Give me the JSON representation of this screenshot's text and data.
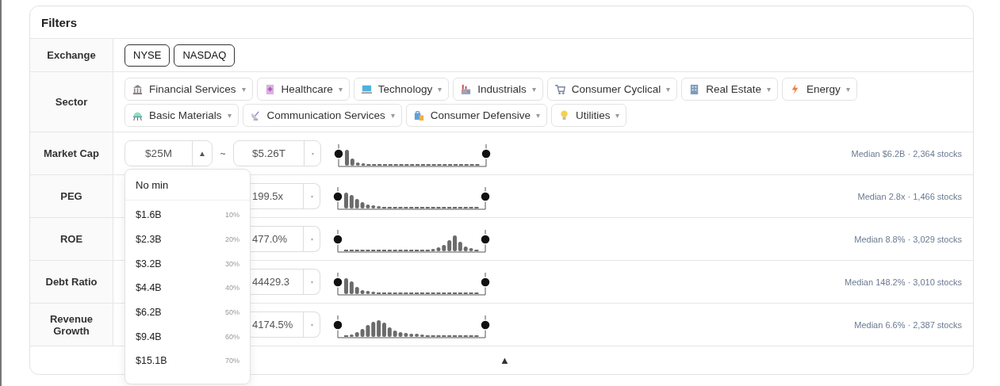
{
  "title": "Filters",
  "exchange": {
    "label": "Exchange",
    "options": [
      {
        "label": "NYSE"
      },
      {
        "label": "NASDAQ"
      }
    ]
  },
  "sector": {
    "label": "Sector",
    "options": [
      {
        "label": "Financial Services",
        "caret": "▾"
      },
      {
        "label": "Healthcare",
        "caret": "▾"
      },
      {
        "label": "Technology",
        "caret": "▾"
      },
      {
        "label": "Industrials",
        "caret": "▾"
      },
      {
        "label": "Consumer Cyclical",
        "caret": "▾"
      },
      {
        "label": "Real Estate",
        "caret": "▾"
      },
      {
        "label": "Energy",
        "caret": "▾"
      },
      {
        "label": "Basic Materials",
        "caret": "▾"
      },
      {
        "label": "Communication Services",
        "caret": "▾"
      },
      {
        "label": "Consumer Defensive",
        "caret": "▾"
      },
      {
        "label": "Utilities",
        "caret": "▾"
      }
    ]
  },
  "metrics": [
    {
      "label": "Market Cap",
      "min": {
        "value": "$25M",
        "stepper": "▲"
      },
      "separator": "~",
      "max": {
        "value": "$5.26T",
        "caret": "▾"
      },
      "handles": [
        {
          "level": 0
        },
        {
          "level": 1
        }
      ],
      "summary": "Median $6.2B · 2,364 stocks"
    },
    {
      "label": "PEG",
      "max": {
        "value": "199.5x",
        "caret": "▾"
      },
      "handles": [
        {
          "level": 0
        },
        {
          "level": 1
        }
      ],
      "summary": "Median 2.8x · 1,466 stocks"
    },
    {
      "label": "ROE",
      "max": {
        "value": "477.0%",
        "caret": "▾"
      },
      "handles": [
        {
          "level": 0
        },
        {
          "level": 1
        }
      ],
      "summary": "Median 8.8% · 3,029 stocks"
    },
    {
      "label": "Debt Ratio",
      "max": {
        "value": "44429.3",
        "caret": "▾"
      },
      "handles": [
        {
          "level": 0
        },
        {
          "level": 1
        }
      ],
      "summary": "Median 148.2% · 3,010 stocks"
    },
    {
      "label": "Revenue Growth",
      "max": {
        "value": "4174.5%",
        "caret": "▾"
      },
      "handles": [
        {
          "level": 0
        },
        {
          "level": 1
        }
      ],
      "summary": "Median 6.6% · 2,387 stocks"
    }
  ],
  "dropdown": {
    "header": "No min",
    "options": [
      {
        "value": "$1.6B",
        "percentile": "10%"
      },
      {
        "value": "$2.3B",
        "percentile": "20%"
      },
      {
        "value": "$3.2B",
        "percentile": "30%"
      },
      {
        "value": "$4.4B",
        "percentile": "40%"
      },
      {
        "value": "$6.2B",
        "percentile": "50%"
      },
      {
        "value": "$9.4B",
        "percentile": "60%"
      },
      {
        "value": "$15.1B",
        "percentile": "70%"
      }
    ]
  },
  "collapse_toggle": "▲"
}
